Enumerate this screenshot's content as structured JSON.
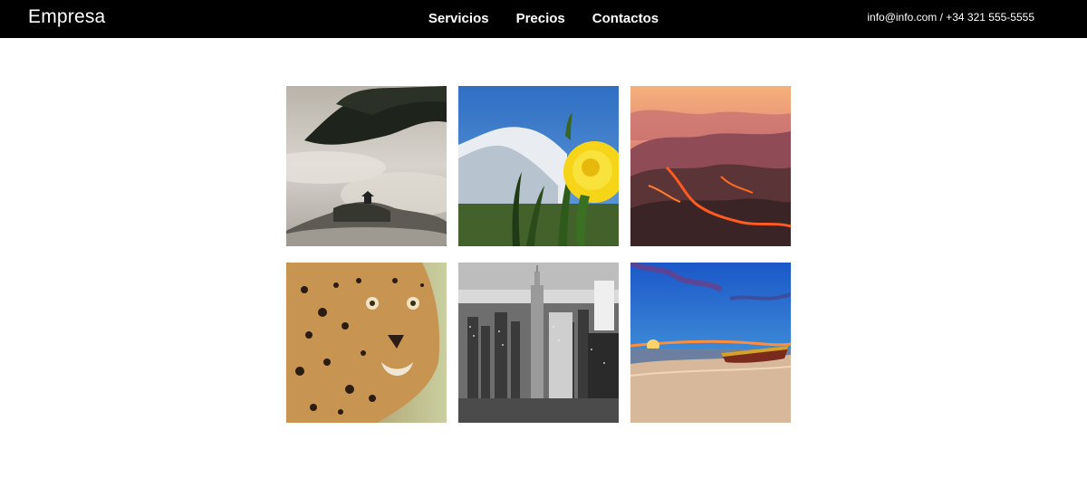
{
  "header": {
    "brand": "Empresa",
    "nav": [
      {
        "label": "Servicios"
      },
      {
        "label": "Precios"
      },
      {
        "label": "Contactos"
      }
    ],
    "contact": "info@info.com / +34 321 555-5555",
    "background": "#000000",
    "text_color": "#ffffff"
  },
  "gallery": {
    "images": [
      {
        "subject": "misty-forested-hills-with-pagoda"
      },
      {
        "subject": "dandelion-with-snowy-mountain"
      },
      {
        "subject": "volcanic-mountains-with-lava-flows"
      },
      {
        "subject": "leopard-portrait"
      },
      {
        "subject": "black-and-white-city-skyline"
      },
      {
        "subject": "beach-sunset-with-boat"
      }
    ]
  }
}
